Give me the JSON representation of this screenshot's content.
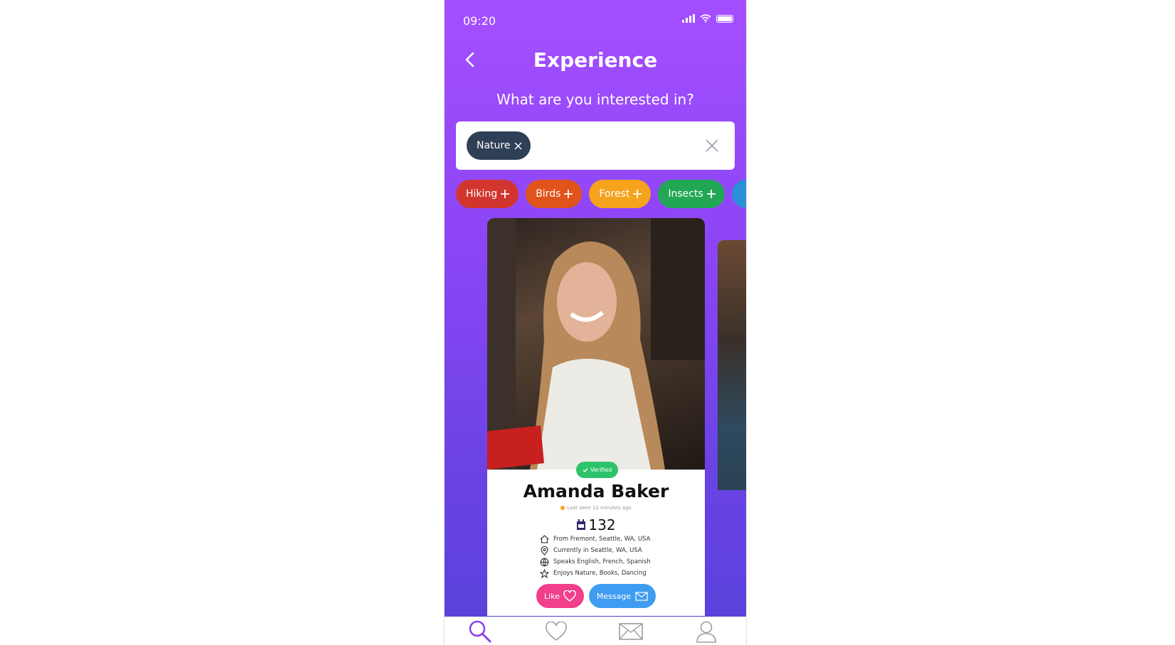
{
  "status_bar": {
    "time": "09:20"
  },
  "header": {
    "title": "Experience",
    "subtitle": "What are you interested in?"
  },
  "search": {
    "selected_chip": "Nature"
  },
  "tags": [
    {
      "label": "Hiking",
      "color": "#d2352e"
    },
    {
      "label": "Birds",
      "color": "#e0531a"
    },
    {
      "label": "Forest",
      "color": "#f5a21d"
    },
    {
      "label": "Insects",
      "color": "#22a855"
    },
    {
      "label": "",
      "color": "#2b8fd6"
    }
  ],
  "profile": {
    "verified_label": "Verified",
    "name": "Amanda Baker",
    "last_seen": "Last seen 12 minutes ago",
    "score": "132",
    "facts": [
      {
        "icon": "home-icon",
        "text": "From Fremont, Seattle, WA, USA"
      },
      {
        "icon": "location-pin-icon",
        "text": "Currently in Seattle, WA, USA"
      },
      {
        "icon": "globe-icon",
        "text": "Speaks English, French, Spanish"
      },
      {
        "icon": "star-icon",
        "text": "Enjoys Nature, Books, Dancing"
      }
    ],
    "like_label": "Like",
    "message_label": "Message"
  },
  "colors": {
    "gradient_top": "#a44fff",
    "gradient_bottom": "#5841d9",
    "active_tab": "#8a3ff0"
  },
  "tabbar": [
    "search-icon",
    "heart-icon",
    "mail-icon",
    "user-icon"
  ]
}
